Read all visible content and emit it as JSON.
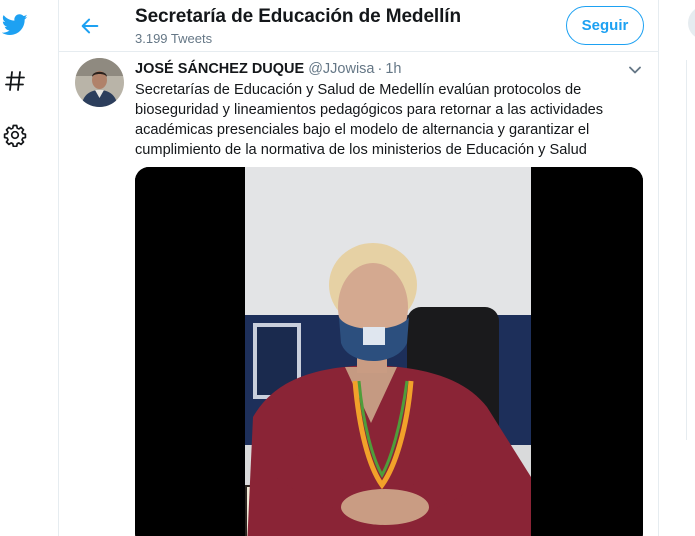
{
  "header": {
    "title": "Secretaría de Educación de Medellín",
    "tweet_count": "3.199 Tweets",
    "follow_label": "Seguir"
  },
  "nav": {
    "icons": [
      "twitter-bird-icon",
      "hashtag-icon",
      "gear-icon"
    ]
  },
  "tweet": {
    "author_name": "JOSÉ SÁNCHEZ DUQUE",
    "handle": "@JJowisa",
    "separator": "·",
    "time": "1h",
    "text": "Secretarías de Educación y Salud de Medellín evalúan protocolos de\nbioseguridad y lineamientos pedagógicos para retornar a las  actividades\nacadémicas presenciales bajo el modelo de alternancia y garantizar el\ncumplimiento de la normativa de los ministerios de Educación y Salud"
  },
  "colors": {
    "accent": "#1da1f2",
    "text_primary": "#14171a",
    "text_secondary": "#657786",
    "border": "#e6ecf0"
  }
}
